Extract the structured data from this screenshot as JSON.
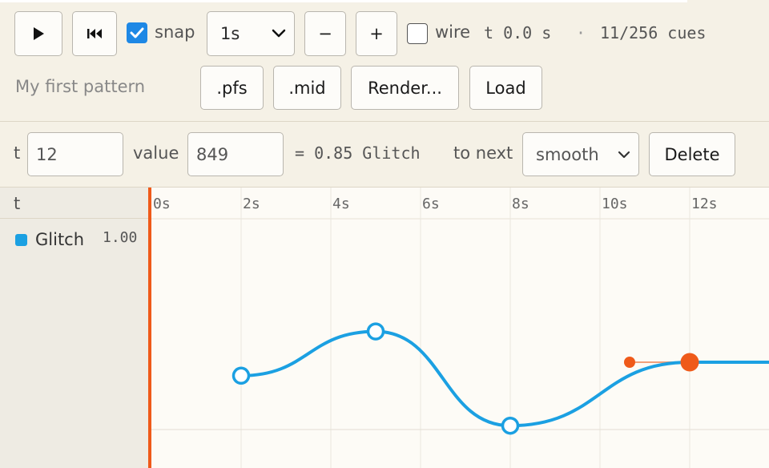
{
  "toolbar": {
    "play_icon": "play-icon",
    "rewind_icon": "skip-to-start-icon",
    "snap_label": "snap",
    "snap_checked": true,
    "snap_interval": "1s",
    "minus_label": "−",
    "plus_label": "+",
    "wire_label": "wire",
    "wire_checked": false,
    "time_readout": "t 0.0 s",
    "separator": "·",
    "cue_count": "11/256 cues",
    "pattern_name": "My first pattern",
    "pfs_label": ".pfs",
    "mid_label": ".mid",
    "render_label": "Render...",
    "load_label": "Load"
  },
  "editor": {
    "t_label": "t",
    "t_value": "12",
    "value_label": "value",
    "value_value": "849",
    "computed": "= 0.85 Glitch",
    "to_next_label": "to next",
    "interpolation": "smooth",
    "delete_label": "Delete"
  },
  "tracks": {
    "header_label": "t",
    "items": [
      {
        "name": "Glitch",
        "max": "1.00",
        "color": "#1ba0e2"
      }
    ]
  },
  "timeline": {
    "ticks": [
      "0s",
      "2s",
      "4s",
      "6s",
      "8s",
      "10s",
      "12s"
    ],
    "accent": "#ef5a1a",
    "curve_color": "#1ba0e2",
    "keyframes": [
      {
        "t": 2,
        "value": 0.28,
        "selected": false
      },
      {
        "t": 5,
        "value": 0.51,
        "selected": false
      },
      {
        "t": 8,
        "value": 0.02,
        "selected": false
      },
      {
        "t": 12,
        "value": 0.35,
        "selected": true
      }
    ]
  }
}
